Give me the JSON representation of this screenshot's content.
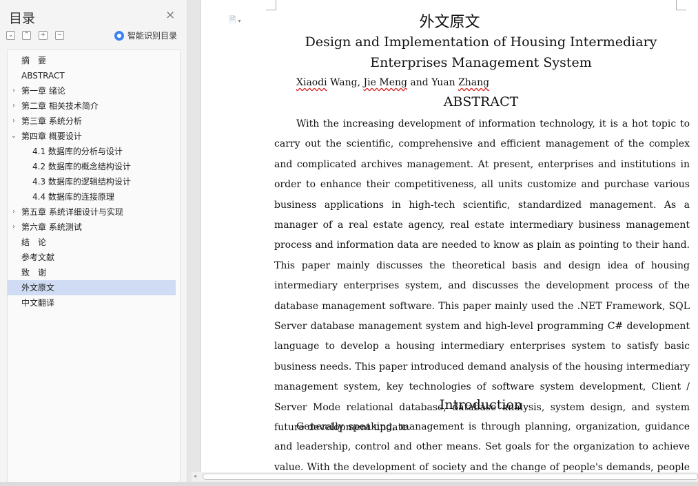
{
  "sidebar": {
    "title": "目录",
    "close_glyph": "×",
    "toolbar": {
      "collapse_all": "⌄",
      "expand_up": "⌃",
      "add": "+",
      "remove": "−",
      "ai_label": "智能识别目录"
    },
    "toc": [
      {
        "label": "摘　要",
        "level": 0,
        "arrow": ""
      },
      {
        "label": "ABSTRACT",
        "level": 0,
        "arrow": ""
      },
      {
        "label": "第一章  绪论",
        "level": 0,
        "arrow": "›"
      },
      {
        "label": "第二章  相关技术简介",
        "level": 0,
        "arrow": "›"
      },
      {
        "label": "第三章  系统分析",
        "level": 0,
        "arrow": "›"
      },
      {
        "label": "第四章  概要设计",
        "level": 0,
        "arrow": "⌄"
      },
      {
        "label": "4.1 数据库的分析与设计",
        "level": 1,
        "arrow": ""
      },
      {
        "label": "4.2 数据库的概念结构设计",
        "level": 1,
        "arrow": ""
      },
      {
        "label": "4.3 数据库的逻辑结构设计",
        "level": 1,
        "arrow": ""
      },
      {
        "label": "4.4 数据库的连接原理",
        "level": 1,
        "arrow": ""
      },
      {
        "label": "第五章  系统详细设计与实现",
        "level": 0,
        "arrow": "›"
      },
      {
        "label": "第六章  系统测试",
        "level": 0,
        "arrow": "›"
      },
      {
        "label": "结　论",
        "level": 0,
        "arrow": ""
      },
      {
        "label": "参考文献",
        "level": 0,
        "arrow": ""
      },
      {
        "label": "致　谢",
        "level": 0,
        "arrow": ""
      },
      {
        "label": "外文原文",
        "level": 0,
        "arrow": "",
        "selected": true
      },
      {
        "label": "中文翻译",
        "level": 0,
        "arrow": ""
      }
    ]
  },
  "document": {
    "title_cn": "外文原文",
    "title_en": "Design and Implementation of Housing Intermediary Enterprises Management System",
    "authors": {
      "a1": "Xiaodi",
      "a1_rest": " Wang, ",
      "a2": "Jie Meng",
      "sep": " and Yuan ",
      "a3": "Zhang"
    },
    "abstract_heading": "ABSTRACT",
    "abstract_text": "With the increasing development of information technology, it is a hot topic to carry out the scientific, comprehensive and efficient management of the complex and complicated archives management. At present, enterprises and institutions in order to enhance their competitiveness, all units customize and purchase various business applications in high-tech scientific, standardized management. As a manager of a real estate agency, real estate intermediary business management process and information data are needed to know as plain as pointing to their hand. This paper mainly discusses the theoretical basis and design idea of housing intermediary enterprises system, and discusses the development process of the database management software. This paper mainly used the .NET Framework, SQL Server database management system and high-level programming C# development language to develop a housing intermediary enterprises system to satisfy basic business needs. This paper introduced demand analysis of the housing intermediary management system, key technologies of software system development, Client / Server Mode relational database, database analysis, system design, and system future development update.",
    "intro_heading": "Introduction",
    "intro_text": "Generally speaking, management is through planning, organization, guidance and leadership, control and other means. Set goals for the organization to achieve value. With the development of society and the change of people's demands, people pay more and more attention to management."
  },
  "colors": {
    "selected_bg": "#cfdcf3",
    "ai_icon": "#3b82f6",
    "spell_underline": "#d33"
  },
  "icons": {
    "doc_icon": "document-icon",
    "ai_icon": "ai-recognize-icon",
    "close": "close-icon"
  }
}
